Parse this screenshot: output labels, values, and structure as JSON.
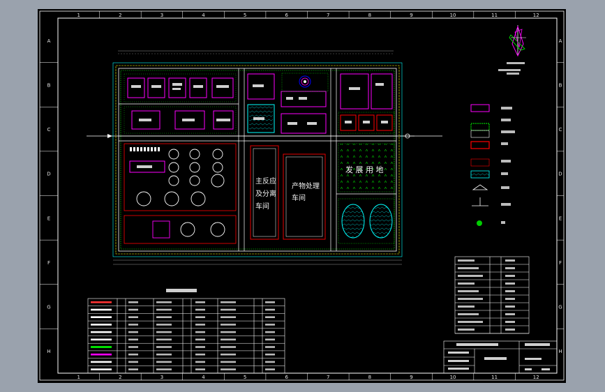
{
  "grid": {
    "columns": [
      "1",
      "2",
      "3",
      "4",
      "5",
      "6",
      "7",
      "8",
      "9",
      "10",
      "11",
      "12"
    ],
    "rows": [
      "A",
      "B",
      "C",
      "D",
      "E",
      "F",
      "G",
      "H"
    ]
  },
  "site": {
    "reactor_building": [
      "主反应",
      "及分离",
      "车间"
    ],
    "product_building": [
      "产物处理",
      "车间"
    ],
    "development_area": "发 展 用 地"
  },
  "colors": {
    "magenta": "#ff00ff",
    "green": "#00ff00",
    "red": "#ff0000",
    "cyan": "#00ffff",
    "white": "#ffffff",
    "yellow": "#ffff00",
    "blue": "#0000ff"
  },
  "icons": [
    "compass-icon",
    "entrance-icon",
    "tree-icon"
  ]
}
